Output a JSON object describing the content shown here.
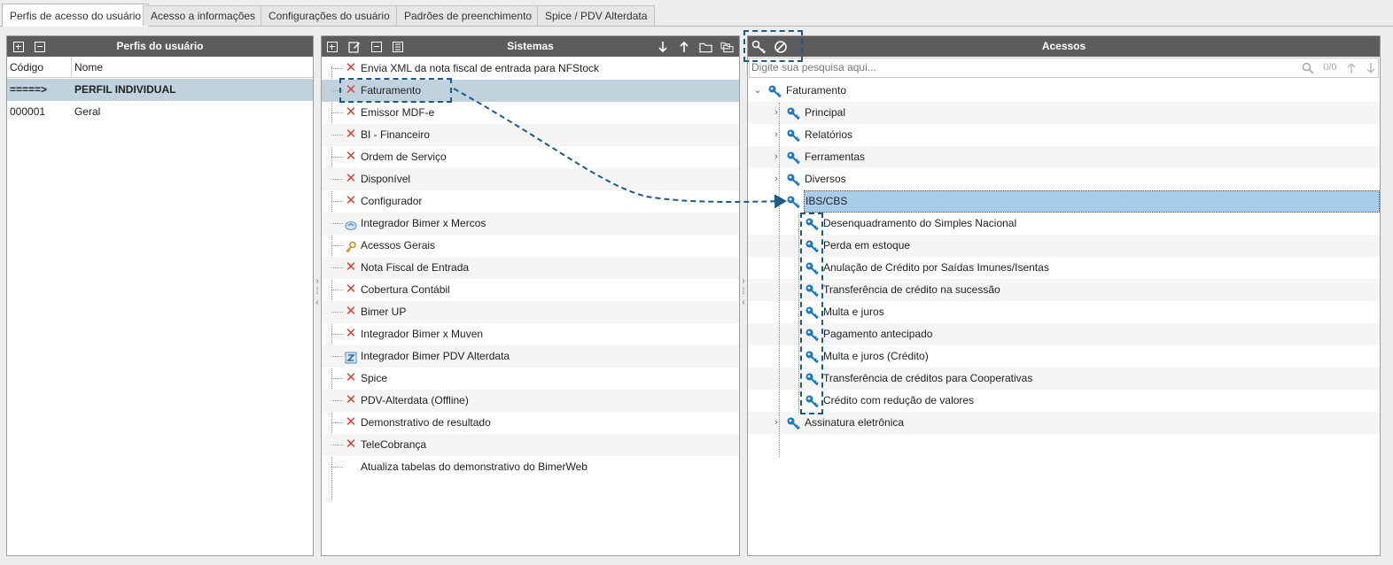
{
  "tabs": [
    "Perfis de acesso do usuário",
    "Acesso a informações",
    "Configurações do usuário",
    "Padrões de preenchimento",
    "Spice / PDV Alterdata"
  ],
  "left_panel": {
    "title": "Perfis do usuário",
    "columns": [
      "Código",
      "Nome"
    ],
    "rows": [
      {
        "code": "=====>",
        "name": "PERFIL INDIVIDUAL"
      },
      {
        "code": "000001",
        "name": "Geral"
      }
    ]
  },
  "systems_panel": {
    "title": "Sistemas",
    "items": [
      {
        "label": "Envia XML da nota fiscal de entrada para NFStock",
        "icon": "x-icon"
      },
      {
        "label": "Faturamento",
        "icon": "x-icon"
      },
      {
        "label": "Emissor MDF-e",
        "icon": "x-icon"
      },
      {
        "label": "BI - Financeiro",
        "icon": "x-icon"
      },
      {
        "label": "Ordem de Serviço",
        "icon": "x-icon"
      },
      {
        "label": "Disponível",
        "icon": "x-icon"
      },
      {
        "label": "Configurador",
        "icon": "x-icon"
      },
      {
        "label": "Integrador Bimer x Mercos",
        "icon": "mercos-icon"
      },
      {
        "label": "Acessos Gerais",
        "icon": "key-icon"
      },
      {
        "label": "Nota Fiscal de Entrada",
        "icon": "x-icon"
      },
      {
        "label": "Cobertura Contábil",
        "icon": "x-icon"
      },
      {
        "label": "Bimer UP",
        "icon": "x-icon"
      },
      {
        "label": "Integrador Bimer x Muven",
        "icon": "x-icon"
      },
      {
        "label": "Integrador Bimer PDV Alterdata",
        "icon": "pdv-icon"
      },
      {
        "label": "Spice",
        "icon": "x-icon"
      },
      {
        "label": "PDV-Alterdata (Offline)",
        "icon": "x-icon"
      },
      {
        "label": "Demonstrativo de resultado",
        "icon": "x-icon"
      },
      {
        "label": "TeleCobrança",
        "icon": "x-icon"
      },
      {
        "label": "Atualiza tabelas do demonstrativo do BimerWeb",
        "icon": "none"
      }
    ]
  },
  "access_panel": {
    "title": "Acessos",
    "search_placeholder": "Digite sua pesquisa aqui...",
    "search_count": "0/0",
    "tree": [
      {
        "label": "Faturamento",
        "level": 0,
        "expander": "v"
      },
      {
        "label": "Principal",
        "level": 1,
        "expander": ">"
      },
      {
        "label": "Relatórios",
        "level": 1,
        "expander": ">"
      },
      {
        "label": "Ferramentas",
        "level": 1,
        "expander": ">"
      },
      {
        "label": "Diversos",
        "level": 1,
        "expander": ">"
      },
      {
        "label": "IBS/CBS",
        "level": 1,
        "expander": "v"
      },
      {
        "label": "Desenquadramento do Simples Nacional",
        "level": 2,
        "expander": ""
      },
      {
        "label": "Perda em estoque",
        "level": 2,
        "expander": ""
      },
      {
        "label": "Anulação de Crédito por Saídas Imunes/Isentas",
        "level": 2,
        "expander": ""
      },
      {
        "label": "Transferência de crédito na sucessão",
        "level": 2,
        "expander": ""
      },
      {
        "label": "Multa e juros",
        "level": 2,
        "expander": ""
      },
      {
        "label": "Pagamento antecipado",
        "level": 2,
        "expander": ""
      },
      {
        "label": "Multa e juros (Crédito)",
        "level": 2,
        "expander": ""
      },
      {
        "label": "Transferência de créditos para Cooperativas",
        "level": 2,
        "expander": ""
      },
      {
        "label": "Crédito com redução de valores",
        "level": 2,
        "expander": ""
      },
      {
        "label": "Assinatura eletrônica",
        "level": 1,
        "expander": ">"
      }
    ]
  },
  "colors": {
    "header": "#5c5c5c",
    "selection": "#bfd2de",
    "highlight": "#a8cdea",
    "x_icon": "#e0402b",
    "key_icon": "#1b78c2",
    "annotation": "#1f5a85"
  }
}
